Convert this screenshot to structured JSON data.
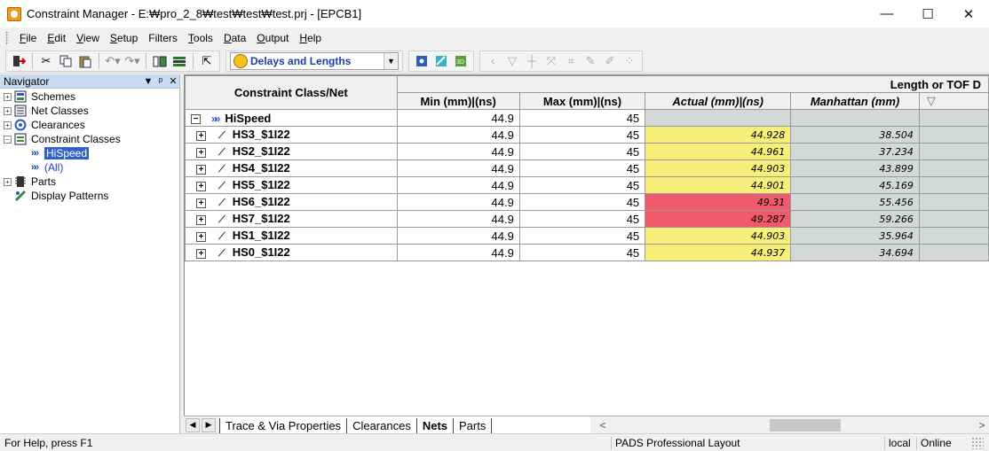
{
  "window": {
    "title": "Constraint Manager - E:₩pro_2_8₩test₩test₩test.prj - [EPCB1]",
    "minimize": "—",
    "maximize": "☐",
    "close": "✕"
  },
  "menu": [
    {
      "key": "F",
      "rest": "ile"
    },
    {
      "key": "E",
      "rest": "dit"
    },
    {
      "key": "V",
      "rest": "iew"
    },
    {
      "key": "S",
      "rest": "etup"
    },
    {
      "key": "",
      "rest": "Filters"
    },
    {
      "key": "T",
      "rest": "ools"
    },
    {
      "key": "D",
      "rest": "ata"
    },
    {
      "key": "O",
      "rest": "utput"
    },
    {
      "key": "H",
      "rest": "elp"
    }
  ],
  "toolbar": {
    "scheme_combo": "Delays and Lengths"
  },
  "navigator": {
    "title": "Navigator",
    "pin": "▼",
    "dock": "ᵖ",
    "close": "✕",
    "items": [
      {
        "label": "Schemes",
        "expander": "+"
      },
      {
        "label": "Net Classes",
        "expander": "+"
      },
      {
        "label": "Clearances",
        "expander": "+"
      },
      {
        "label": "Constraint Classes",
        "expander": "−"
      },
      {
        "label": "HiSpeed"
      },
      {
        "label": "(All)"
      },
      {
        "label": "Parts",
        "expander": "+"
      },
      {
        "label": "Display Patterns"
      }
    ]
  },
  "grid": {
    "col_class_net": "Constraint Class/Net",
    "group_header": "Length or TOF D",
    "col_min": "Min (mm)|(ns)",
    "col_max": "Max (mm)|(ns)",
    "col_actual": "Actual (mm)|(ns)",
    "col_manhattan": "Manhattan (mm)",
    "filter_icon": "▽",
    "class_row": {
      "name": "HiSpeed",
      "min": "44.9",
      "max": "45",
      "expander": "−"
    },
    "rows": [
      {
        "name": "HS3_$1I22",
        "min": "44.9",
        "max": "45",
        "actual": "44.928",
        "manhattan": "38.504",
        "status": "ok"
      },
      {
        "name": "HS2_$1I22",
        "min": "44.9",
        "max": "45",
        "actual": "44.961",
        "manhattan": "37.234",
        "status": "ok"
      },
      {
        "name": "HS4_$1I22",
        "min": "44.9",
        "max": "45",
        "actual": "44.903",
        "manhattan": "43.899",
        "status": "ok"
      },
      {
        "name": "HS5_$1I22",
        "min": "44.9",
        "max": "45",
        "actual": "44.901",
        "manhattan": "45.169",
        "status": "ok"
      },
      {
        "name": "HS6_$1I22",
        "min": "44.9",
        "max": "45",
        "actual": "49.31",
        "manhattan": "55.456",
        "status": "fail"
      },
      {
        "name": "HS7_$1I22",
        "min": "44.9",
        "max": "45",
        "actual": "49.287",
        "manhattan": "59.266",
        "status": "fail"
      },
      {
        "name": "HS1_$1I22",
        "min": "44.9",
        "max": "45",
        "actual": "44.903",
        "manhattan": "35.964",
        "status": "ok"
      },
      {
        "name": "HS0_$1I22",
        "min": "44.9",
        "max": "45",
        "actual": "44.937",
        "manhattan": "34.694",
        "status": "ok"
      }
    ],
    "row_expander": "+"
  },
  "tabs": [
    {
      "label": "Trace & Via Properties",
      "active": false
    },
    {
      "label": "Clearances",
      "active": false
    },
    {
      "label": "Nets",
      "active": true
    },
    {
      "label": "Parts",
      "active": false
    }
  ],
  "scroll": {
    "left": "<",
    "right": ">",
    "tab_prev": "◀",
    "tab_next": "▶"
  },
  "status": {
    "help": "For Help, press F1",
    "product": "PADS Professional Layout",
    "mode": "local",
    "connection": "Online"
  },
  "colors": {
    "ok": "#f6f07a",
    "fail": "#f05a6a",
    "readonly": "#d3d8d8",
    "selection": "#3163c5"
  }
}
